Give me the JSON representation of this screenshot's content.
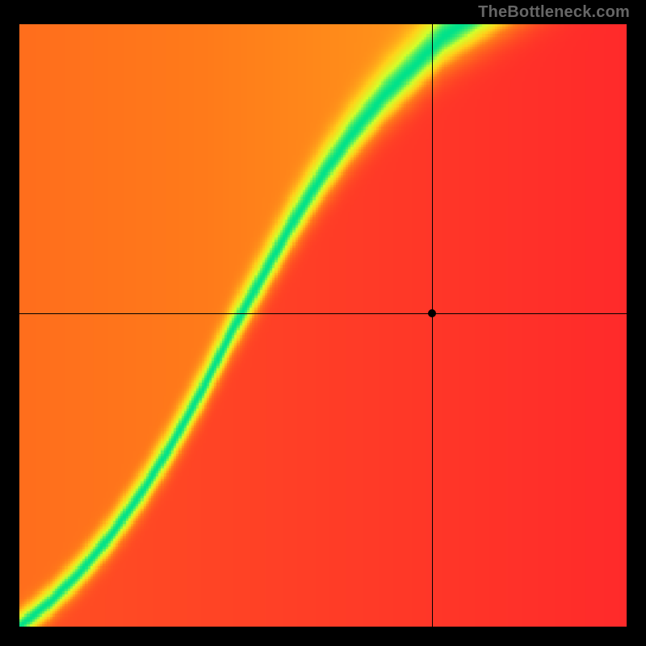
{
  "watermark": "TheBottleneck.com",
  "chart_data": {
    "type": "heatmap",
    "title": "",
    "xlabel": "",
    "ylabel": "",
    "xlim": [
      0,
      1
    ],
    "ylim": [
      0,
      1
    ],
    "crosshair": {
      "x": 0.68,
      "y": 0.52
    },
    "ridge_curve": {
      "description": "Locus of optimal (green) balance; value falls off with distance from this curve.",
      "points": [
        {
          "x": 0.0,
          "y": 0.0
        },
        {
          "x": 0.05,
          "y": 0.04
        },
        {
          "x": 0.1,
          "y": 0.09
        },
        {
          "x": 0.15,
          "y": 0.15
        },
        {
          "x": 0.2,
          "y": 0.22
        },
        {
          "x": 0.25,
          "y": 0.3
        },
        {
          "x": 0.3,
          "y": 0.39
        },
        {
          "x": 0.35,
          "y": 0.49
        },
        {
          "x": 0.4,
          "y": 0.58
        },
        {
          "x": 0.45,
          "y": 0.67
        },
        {
          "x": 0.5,
          "y": 0.75
        },
        {
          "x": 0.55,
          "y": 0.82
        },
        {
          "x": 0.6,
          "y": 0.88
        },
        {
          "x": 0.65,
          "y": 0.93
        },
        {
          "x": 0.7,
          "y": 0.98
        },
        {
          "x": 0.73,
          "y": 1.0
        }
      ]
    },
    "color_scale": {
      "low": "#ff2a2a",
      "mid1": "#ff7a1a",
      "mid2": "#ffd21a",
      "high1": "#d4ff2a",
      "high2": "#00e28a"
    },
    "resolution": 240,
    "band_sigma": 0.032
  }
}
